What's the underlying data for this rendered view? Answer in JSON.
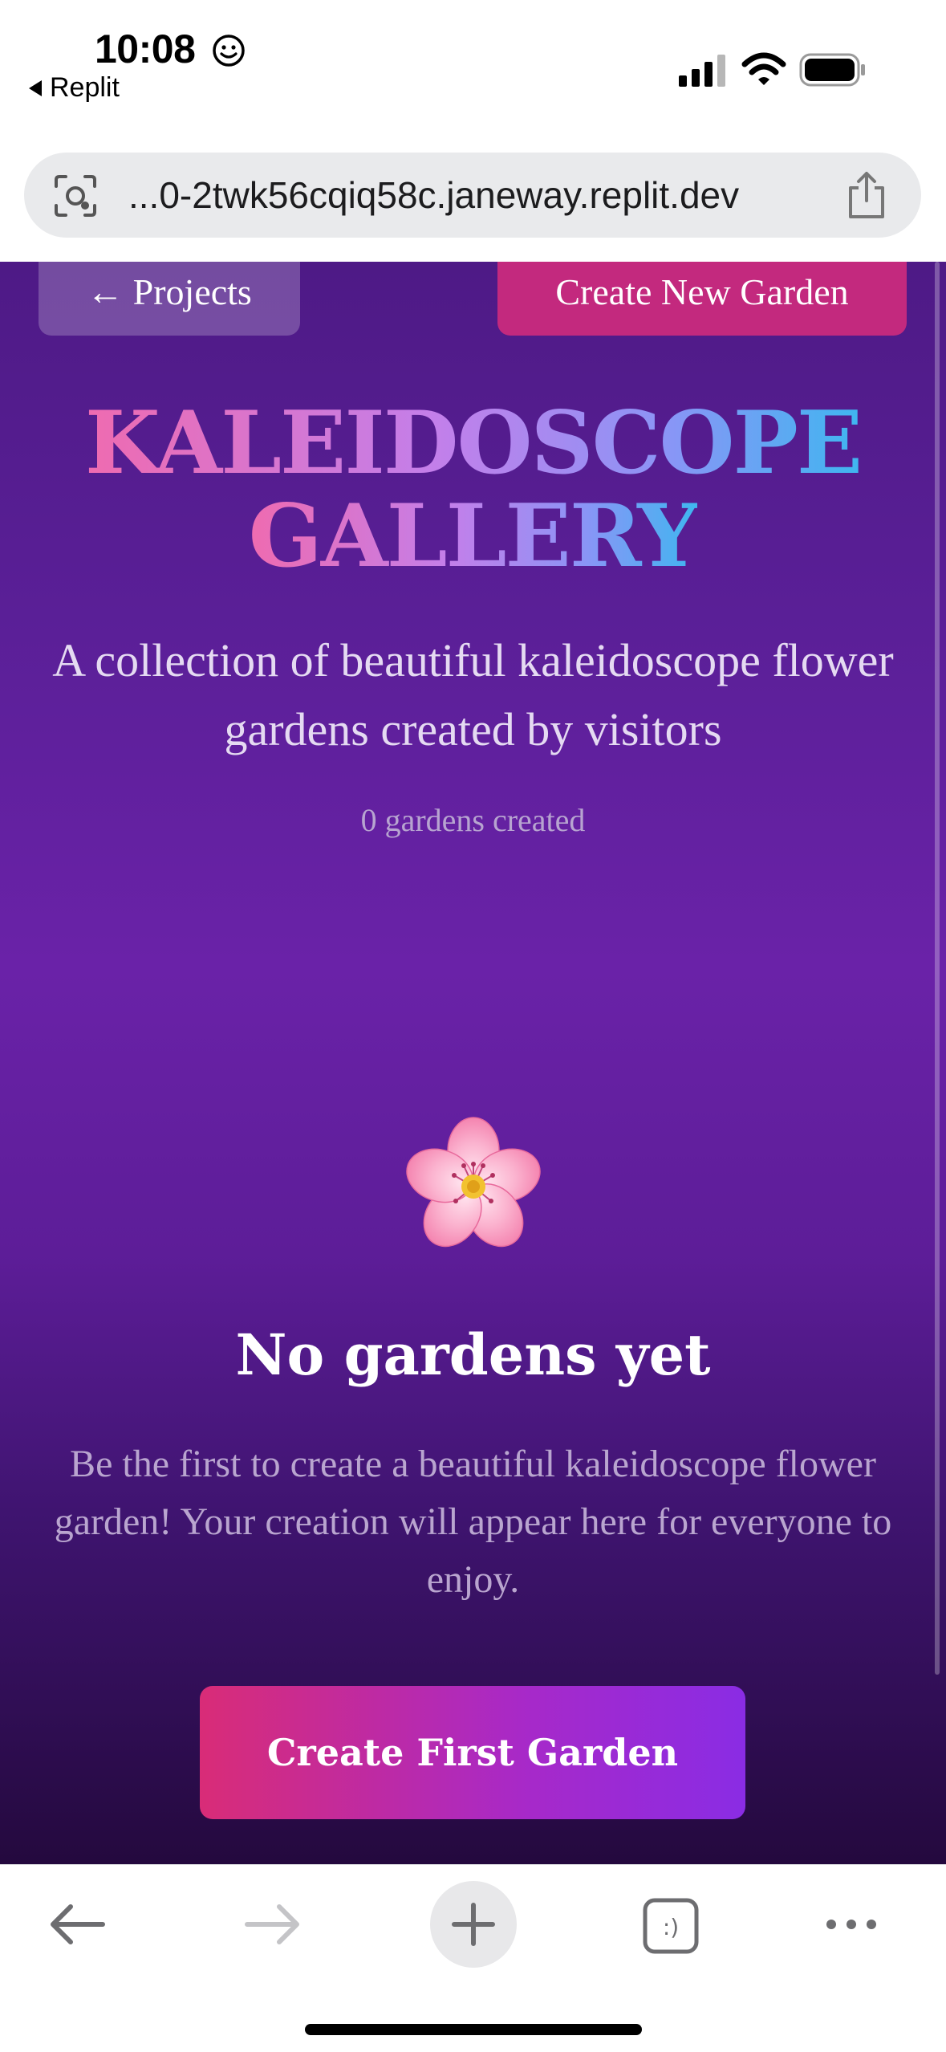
{
  "status_bar": {
    "time": "10:08",
    "back_app": "Replit"
  },
  "browser": {
    "url": "...0-2twk56cqiq58c.janeway.replit.dev"
  },
  "nav": {
    "projects_label": "← Projects",
    "create_new_label": "Create New Garden"
  },
  "hero": {
    "title_line1": "KALEIDOSCOPE",
    "title_line2": "GALLERY",
    "subtitle": "A collection of beautiful kaleidoscope flower gardens created by visitors",
    "count_text": "0 gardens created"
  },
  "empty_state": {
    "icon": "cherry-blossom-icon",
    "title": "No gardens yet",
    "description": "Be the first to create a beautiful kaleidoscope flower garden! Your creation will appear here for everyone to enjoy.",
    "cta_label": "Create First Garden"
  },
  "toolbar": {
    "icons": [
      "back-arrow-icon",
      "forward-arrow-icon",
      "new-tab-plus-icon",
      "tabs-icon",
      "more-icon"
    ],
    "tabs_badge": ":)"
  },
  "colors": {
    "page_top": "#4e1a86",
    "page_mid": "#6a22a8",
    "page_bottom": "#24093e",
    "create_new_button": "#c3297e",
    "cta_gradient_start": "#d92c77",
    "cta_gradient_end": "#8a2ce4",
    "title_gradient": [
      "#ef6bb0",
      "#c37fea",
      "#8a95f6",
      "#3fb6f0"
    ]
  }
}
